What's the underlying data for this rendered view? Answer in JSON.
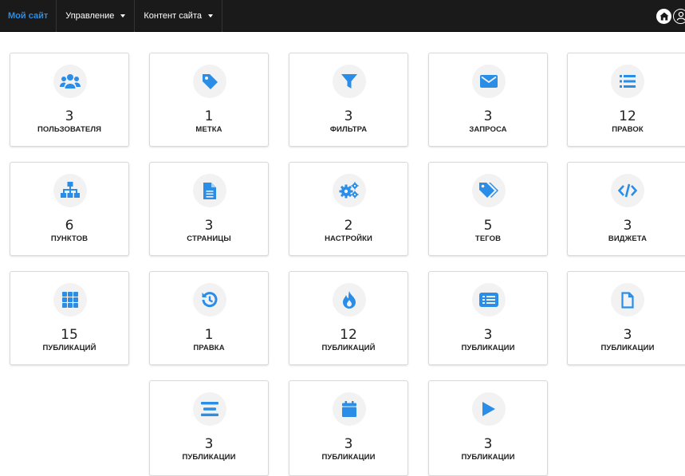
{
  "nav": {
    "brand": "Мой сайт",
    "manage": "Управление",
    "content": "Контент сайта",
    "home_icon": "home-icon",
    "user_icon": "user-icon"
  },
  "accent_color": "#2a8de8",
  "tiles": [
    {
      "count": "3",
      "label": "ПОЛЬЗОВАТЕЛЯ",
      "icon": "users-icon"
    },
    {
      "count": "1",
      "label": "МЕТКА",
      "icon": "tag-icon"
    },
    {
      "count": "3",
      "label": "ФИЛЬТРА",
      "icon": "filter-icon"
    },
    {
      "count": "3",
      "label": "ЗАПРОСА",
      "icon": "envelope-icon"
    },
    {
      "count": "12",
      "label": "ПРАВОК",
      "icon": "list-icon"
    },
    {
      "count": "6",
      "label": "ПУНКТОВ",
      "icon": "sitemap-icon"
    },
    {
      "count": "3",
      "label": "СТРАНИЦЫ",
      "icon": "file-icon"
    },
    {
      "count": "2",
      "label": "НАСТРОЙКИ",
      "icon": "cogs-icon"
    },
    {
      "count": "5",
      "label": "ТЕГОВ",
      "icon": "tags-icon"
    },
    {
      "count": "3",
      "label": "ВИДЖЕТА",
      "icon": "code-icon"
    },
    {
      "count": "15",
      "label": "ПУБЛИКАЦИЙ",
      "icon": "grid-icon"
    },
    {
      "count": "1",
      "label": "ПРАВКА",
      "icon": "history-icon"
    },
    {
      "count": "12",
      "label": "ПУБЛИКАЦИЙ",
      "icon": "fire-icon"
    },
    {
      "count": "3",
      "label": "ПУБЛИКАЦИИ",
      "icon": "card-list-icon"
    },
    {
      "count": "3",
      "label": "ПУБЛИКАЦИИ",
      "icon": "file-outline-icon"
    },
    {
      "count": "3",
      "label": "ПУБЛИКАЦИИ",
      "icon": "align-icon"
    },
    {
      "count": "3",
      "label": "ПУБЛИКАЦИИ",
      "icon": "calendar-icon"
    },
    {
      "count": "3",
      "label": "ПУБЛИКАЦИИ",
      "icon": "play-icon"
    }
  ]
}
